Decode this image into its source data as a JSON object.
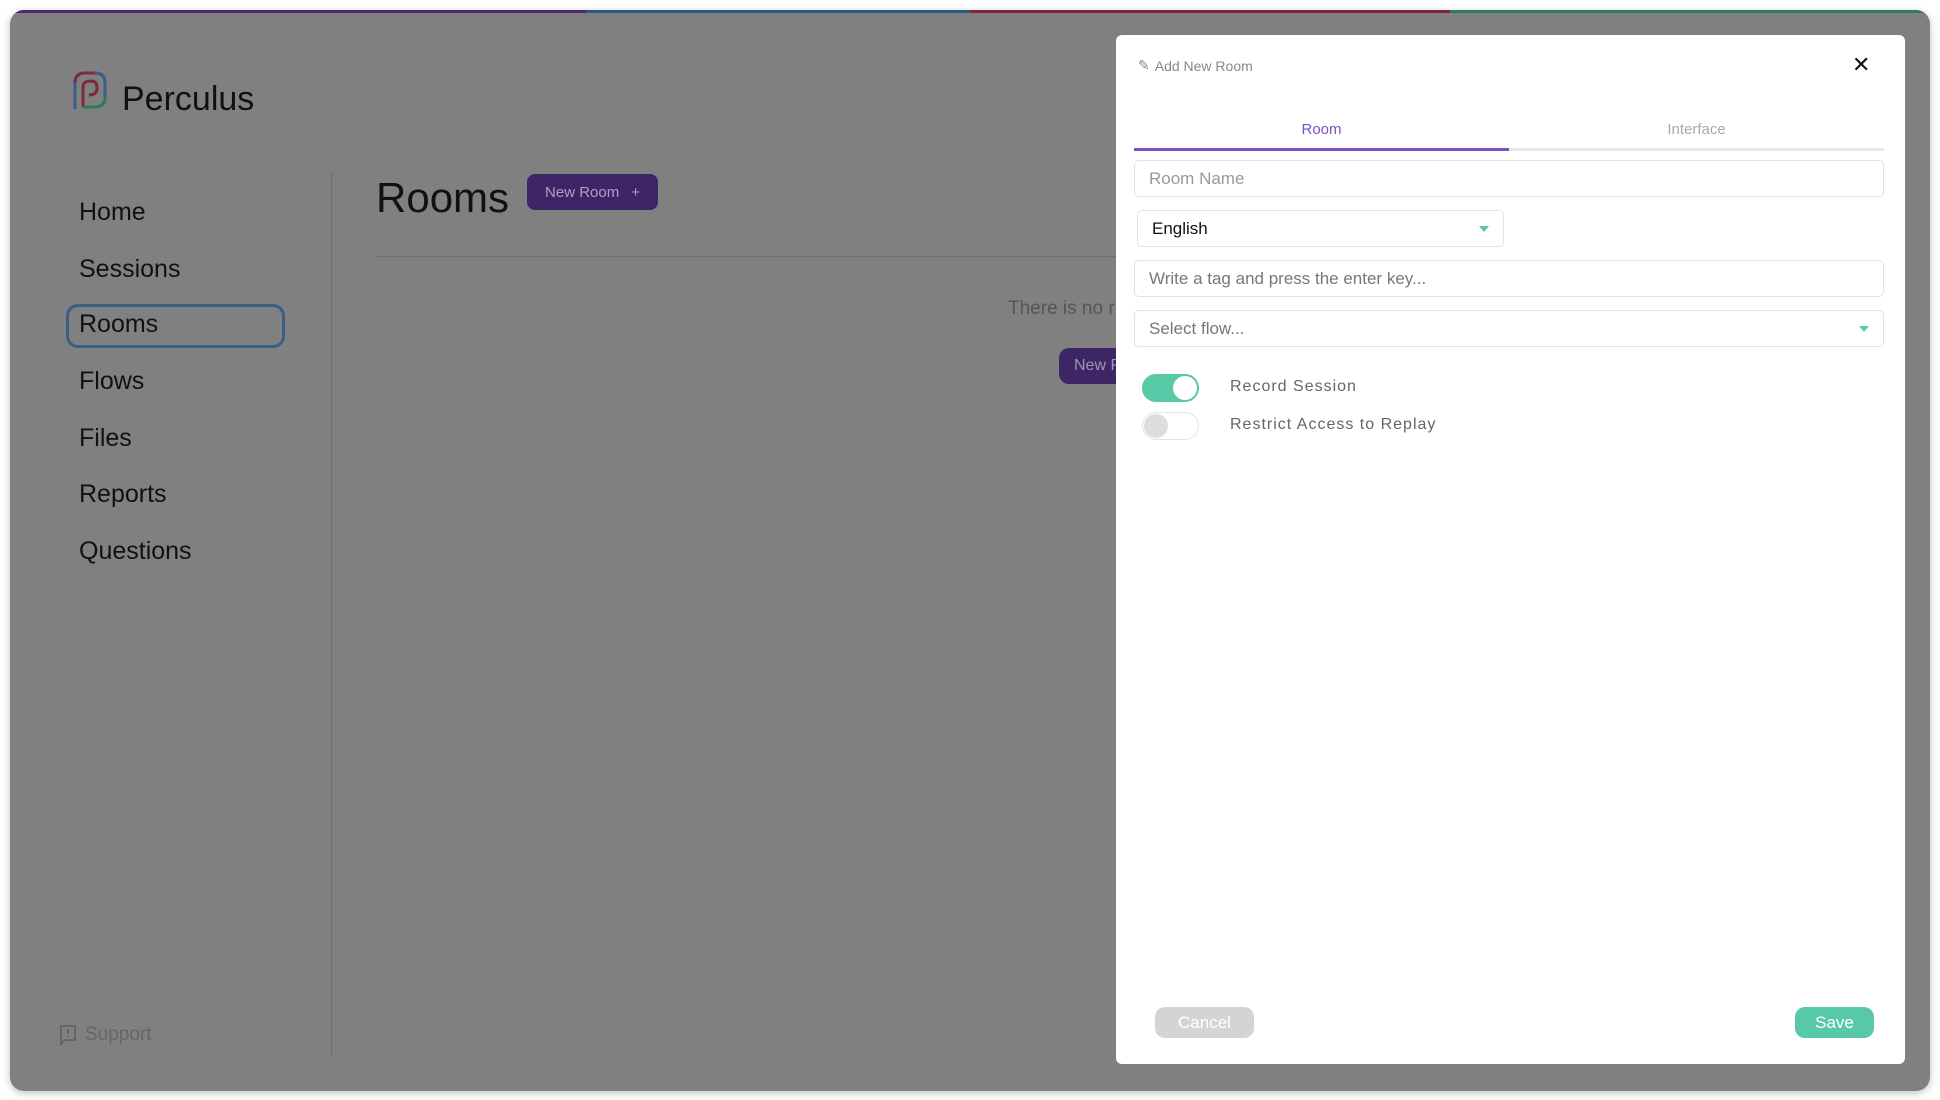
{
  "brand": {
    "name": "Perculus"
  },
  "sidebar": {
    "items": [
      {
        "label": "Home"
      },
      {
        "label": "Sessions"
      },
      {
        "label": "Rooms",
        "active": true
      },
      {
        "label": "Flows"
      },
      {
        "label": "Files"
      },
      {
        "label": "Reports"
      },
      {
        "label": "Questions"
      }
    ],
    "support": "Support"
  },
  "main": {
    "title": "Rooms",
    "new_room_button": "New Room",
    "new_room_icon": "plus-icon",
    "empty_text": "There is no r",
    "empty_button": "New R"
  },
  "modal": {
    "title": "Add New Room",
    "title_icon": "pencil-icon",
    "close_icon": "close-icon",
    "tabs": [
      {
        "label": "Room",
        "active": true
      },
      {
        "label": "Interface",
        "active": false
      }
    ],
    "room_name_placeholder": "Room Name",
    "language_value": "English",
    "tag_placeholder": "Write a tag and press the enter key...",
    "flow_placeholder": "Select flow...",
    "toggles": [
      {
        "label": "Record Session",
        "on": true
      },
      {
        "label": "Restrict Access to Replay",
        "on": false
      }
    ],
    "cancel": "Cancel",
    "save": "Save"
  },
  "colors": {
    "accent": "#7b4fc9",
    "brand_button": "#3d2566",
    "success": "#57c9a6",
    "overlay": "#808080"
  }
}
